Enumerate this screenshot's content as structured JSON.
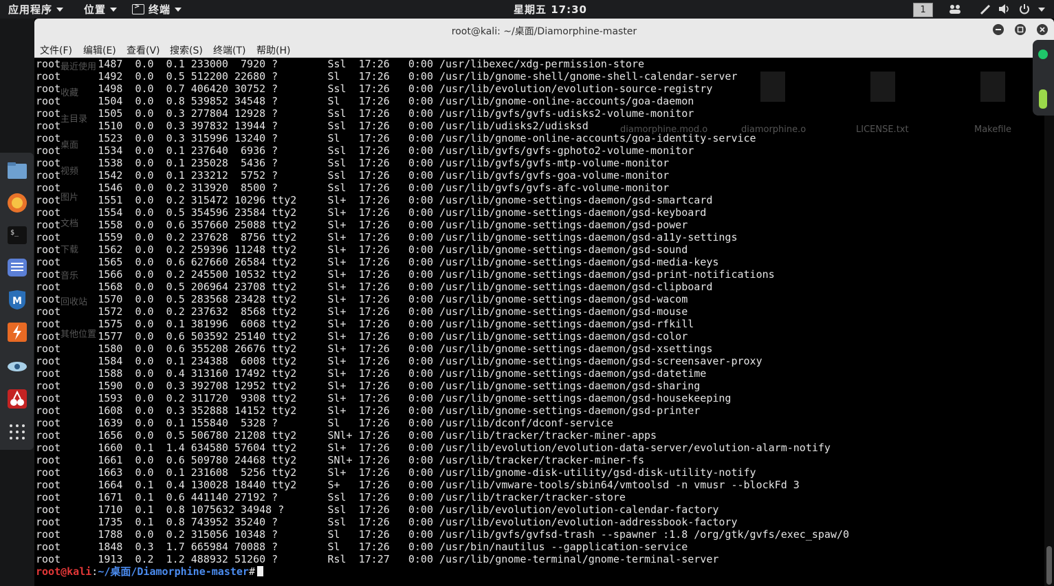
{
  "top_panel": {
    "apps_menu": "应用程序",
    "places_menu": "位置",
    "terminal_menu": "终端",
    "clock": "星期五 17:30",
    "workspace": "1"
  },
  "window": {
    "title": "root@kali: ~/桌面/Diamorphine-master",
    "menus": [
      "文件(F)",
      "编辑(E)",
      "查看(V)",
      "搜索(S)",
      "终端(T)",
      "帮助(H)"
    ]
  },
  "background_ghost": {
    "sidebar": [
      "最近使用",
      "收藏",
      "主目录",
      "桌面",
      "视频",
      "图片",
      "文档",
      "下载",
      "音乐",
      "回收站",
      "其他位置"
    ],
    "files": [
      "diamorphine.mod.o",
      "diamorphine.o",
      "LICENSE.txt",
      "Makefile"
    ]
  },
  "terminal": {
    "lines": [
      "root      1487  0.0  0.1 233000  7920 ?        Ssl  17:26   0:00 /usr/libexec/xdg-permission-store",
      "root      1492  0.0  0.5 512200 22680 ?        Sl   17:26   0:00 /usr/lib/gnome-shell/gnome-shell-calendar-server",
      "root      1498  0.0  0.7 406420 30752 ?        Ssl  17:26   0:00 /usr/lib/evolution/evolution-source-registry",
      "root      1504  0.0  0.8 539852 34548 ?        Sl   17:26   0:00 /usr/lib/gnome-online-accounts/goa-daemon",
      "root      1505  0.0  0.3 277804 12928 ?        Ssl  17:26   0:00 /usr/lib/gvfs/gvfs-udisks2-volume-monitor",
      "root      1510  0.0  0.3 397832 13944 ?        Ssl  17:26   0:00 /usr/lib/udisks2/udisksd",
      "root      1523  0.0  0.3 315996 13240 ?        Sl   17:26   0:00 /usr/lib/gnome-online-accounts/goa-identity-service",
      "root      1534  0.0  0.1 237640  6936 ?        Ssl  17:26   0:00 /usr/lib/gvfs/gvfs-gphoto2-volume-monitor",
      "root      1538  0.0  0.1 235028  5436 ?        Ssl  17:26   0:00 /usr/lib/gvfs/gvfs-mtp-volume-monitor",
      "root      1542  0.0  0.1 233212  5752 ?        Ssl  17:26   0:00 /usr/lib/gvfs/gvfs-goa-volume-monitor",
      "root      1546  0.0  0.2 313920  8500 ?        Ssl  17:26   0:00 /usr/lib/gvfs/gvfs-afc-volume-monitor",
      "root      1551  0.0  0.2 315472 10296 tty2     Sl+  17:26   0:00 /usr/lib/gnome-settings-daemon/gsd-smartcard",
      "root      1554  0.0  0.5 354596 23584 tty2     Sl+  17:26   0:00 /usr/lib/gnome-settings-daemon/gsd-keyboard",
      "root      1558  0.0  0.6 357660 25088 tty2     Sl+  17:26   0:00 /usr/lib/gnome-settings-daemon/gsd-power",
      "root      1559  0.0  0.2 237628  8756 tty2     Sl+  17:26   0:00 /usr/lib/gnome-settings-daemon/gsd-a11y-settings",
      "root      1562  0.0  0.2 259396 11248 tty2     Sl+  17:26   0:00 /usr/lib/gnome-settings-daemon/gsd-sound",
      "root      1565  0.0  0.6 627660 26584 tty2     Sl+  17:26   0:00 /usr/lib/gnome-settings-daemon/gsd-media-keys",
      "root      1566  0.0  0.2 245500 10532 tty2     Sl+  17:26   0:00 /usr/lib/gnome-settings-daemon/gsd-print-notifications",
      "root      1568  0.0  0.5 206964 23708 tty2     Sl+  17:26   0:00 /usr/lib/gnome-settings-daemon/gsd-clipboard",
      "root      1570  0.0  0.5 283568 23428 tty2     Sl+  17:26   0:00 /usr/lib/gnome-settings-daemon/gsd-wacom",
      "root      1572  0.0  0.2 237632  8568 tty2     Sl+  17:26   0:00 /usr/lib/gnome-settings-daemon/gsd-mouse",
      "root      1575  0.0  0.1 381996  6068 tty2     Sl+  17:26   0:00 /usr/lib/gnome-settings-daemon/gsd-rfkill",
      "root      1577  0.0  0.6 503592 25140 tty2     Sl+  17:26   0:00 /usr/lib/gnome-settings-daemon/gsd-color",
      "root      1580  0.0  0.6 355208 26676 tty2     Sl+  17:26   0:00 /usr/lib/gnome-settings-daemon/gsd-xsettings",
      "root      1584  0.0  0.1 234388  6008 tty2     Sl+  17:26   0:00 /usr/lib/gnome-settings-daemon/gsd-screensaver-proxy",
      "root      1588  0.0  0.4 313160 17492 tty2     Sl+  17:26   0:00 /usr/lib/gnome-settings-daemon/gsd-datetime",
      "root      1590  0.0  0.3 392708 12952 tty2     Sl+  17:26   0:00 /usr/lib/gnome-settings-daemon/gsd-sharing",
      "root      1593  0.0  0.2 311720  9308 tty2     Sl+  17:26   0:00 /usr/lib/gnome-settings-daemon/gsd-housekeeping",
      "root      1608  0.0  0.3 352888 14152 tty2     Sl+  17:26   0:00 /usr/lib/gnome-settings-daemon/gsd-printer",
      "root      1639  0.0  0.1 155840  5328 ?        Sl   17:26   0:00 /usr/lib/dconf/dconf-service",
      "root      1656  0.0  0.5 506780 21208 tty2     SNl+ 17:26   0:00 /usr/lib/tracker/tracker-miner-apps",
      "root      1660  0.1  1.4 634580 57604 tty2     Sl+  17:26   0:00 /usr/lib/evolution/evolution-data-server/evolution-alarm-notify",
      "root      1661  0.0  0.6 509780 24468 tty2     SNl+ 17:26   0:00 /usr/lib/tracker/tracker-miner-fs",
      "root      1663  0.0  0.1 231608  5256 tty2     Sl+  17:26   0:00 /usr/lib/gnome-disk-utility/gsd-disk-utility-notify",
      "root      1664  0.1  0.4 130028 18440 tty2     S+   17:26   0:00 /usr/lib/vmware-tools/sbin64/vmtoolsd -n vmusr --blockFd 3",
      "root      1671  0.1  0.6 441140 27192 ?        Ssl  17:26   0:00 /usr/lib/tracker/tracker-store",
      "root      1710  0.1  0.8 1075632 34948 ?       Ssl  17:26   0:00 /usr/lib/evolution/evolution-calendar-factory",
      "root      1735  0.1  0.8 743952 35240 ?        Ssl  17:26   0:00 /usr/lib/evolution/evolution-addressbook-factory",
      "root      1788  0.0  0.2 315056 10348 ?        Sl   17:26   0:00 /usr/lib/gvfs/gvfsd-trash --spawner :1.8 /org/gtk/gvfs/exec_spaw/0",
      "root      1848  0.3  1.7 665984 70088 ?        Sl   17:26   0:00 /usr/bin/nautilus --gapplication-service",
      "root      1913  0.2  1.2 488932 51260 ?        Rsl  17:27   0:00 /usr/lib/gnome-terminal/gnome-terminal-server"
    ],
    "prompt_user": "root@kali",
    "prompt_sep": ":",
    "prompt_path": "~/桌面/Diamorphine-master",
    "prompt_symbol": "#"
  }
}
